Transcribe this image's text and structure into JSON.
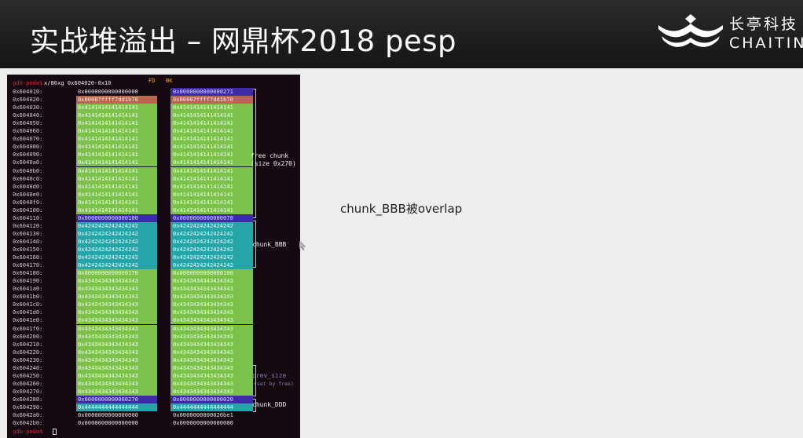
{
  "slide": {
    "title": "实战堆溢出 – 网鼎杯2018 pesp",
    "caption": "chunk_BBB被overlap"
  },
  "logo": {
    "name_cn": "长亭科技",
    "name_en": "CHAITIN",
    "icon": "chaitin-crown-logo-icon"
  },
  "terminal": {
    "prompt": "gdb-peda$",
    "command": "x/86xg 0x604020-0x10",
    "header_fd": "FD",
    "header_bk": "BK",
    "rows": [
      {
        "addr": "0x604010:",
        "c1": "0x0000000000000000",
        "c2": "0x0000000000000271",
        "s1": "k",
        "s2": "p"
      },
      {
        "addr": "0x604020:",
        "c1": "0x00007ffff7dd1b78",
        "c2": "0x00007ffff7dd1b78",
        "s1": "o",
        "s2": "o"
      },
      {
        "addr": "0x604030:",
        "c1": "0x4141414141414141",
        "c2": "0x4141414141414141",
        "s1": "g",
        "s2": "g"
      },
      {
        "addr": "0x604040:",
        "c1": "0x4141414141414141",
        "c2": "0x4141414141414141",
        "s1": "g",
        "s2": "g"
      },
      {
        "addr": "0x604050:",
        "c1": "0x4141414141414141",
        "c2": "0x4141414141414141",
        "s1": "g",
        "s2": "g"
      },
      {
        "addr": "0x604060:",
        "c1": "0x4141414141414141",
        "c2": "0x4141414141414141",
        "s1": "g",
        "s2": "g"
      },
      {
        "addr": "0x604070:",
        "c1": "0x4141414141414141",
        "c2": "0x4141414141414141",
        "s1": "g",
        "s2": "g"
      },
      {
        "addr": "0x604080:",
        "c1": "0x4141414141414141",
        "c2": "0x4141414141414141",
        "s1": "g",
        "s2": "g"
      },
      {
        "addr": "0x604090:",
        "c1": "0x4141414141414141",
        "c2": "0x4141414141414141",
        "s1": "g",
        "s2": "g"
      },
      {
        "addr": "0x6040a0:",
        "c1": "0x4141414141414141",
        "c2": "0x4141414141414141",
        "s1": "g",
        "s2": "g"
      },
      {
        "addr": "0x6040b0:",
        "c1": "0x4141414141414141",
        "c2": "0x4141414141414141",
        "s1": "g",
        "s2": "g"
      },
      {
        "addr": "0x6040c0:",
        "c1": "0x4141414141414141",
        "c2": "0x4141414141414141",
        "s1": "g",
        "s2": "g"
      },
      {
        "addr": "0x6040d0:",
        "c1": "0x4141414141414141",
        "c2": "0x4141414141414141",
        "s1": "g",
        "s2": "g"
      },
      {
        "addr": "0x6040e0:",
        "c1": "0x4141414141414141",
        "c2": "0x4141414141414141",
        "s1": "g",
        "s2": "g"
      },
      {
        "addr": "0x6040f0:",
        "c1": "0x4141414141414141",
        "c2": "0x4141414141414141",
        "s1": "g",
        "s2": "g"
      },
      {
        "addr": "0x604100:",
        "c1": "0x4141414141414141",
        "c2": "0x4141414141414141",
        "s1": "g",
        "s2": "g"
      },
      {
        "addr": "0x604110:",
        "c1": "0x0000000000000100",
        "c2": "0x0000000000000070",
        "s1": "p",
        "s2": "p"
      },
      {
        "addr": "0x604120:",
        "c1": "0x4242424242424242",
        "c2": "0x4242424242424242",
        "s1": "t",
        "s2": "t"
      },
      {
        "addr": "0x604130:",
        "c1": "0x4242424242424242",
        "c2": "0x4242424242424242",
        "s1": "t",
        "s2": "t"
      },
      {
        "addr": "0x604140:",
        "c1": "0x4242424242424242",
        "c2": "0x4242424242424242",
        "s1": "t",
        "s2": "t"
      },
      {
        "addr": "0x604150:",
        "c1": "0x4242424242424242",
        "c2": "0x4242424242424242",
        "s1": "t",
        "s2": "t"
      },
      {
        "addr": "0x604160:",
        "c1": "0x4242424242424242",
        "c2": "0x4242424242424242",
        "s1": "t",
        "s2": "t"
      },
      {
        "addr": "0x604170:",
        "c1": "0x4242424242424242",
        "c2": "0x4242424242424242",
        "s1": "t",
        "s2": "t"
      },
      {
        "addr": "0x604180:",
        "c1": "0x0000000000000170",
        "c2": "0x0000000000000100",
        "s1": "g",
        "s2": "g"
      },
      {
        "addr": "0x604190:",
        "c1": "0x4343434343434343",
        "c2": "0x4343434343434343",
        "s1": "g",
        "s2": "g"
      },
      {
        "addr": "0x6041a0:",
        "c1": "0x4343434343434343",
        "c2": "0x4343434343434343",
        "s1": "g",
        "s2": "g"
      },
      {
        "addr": "0x6041b0:",
        "c1": "0x4343434343434343",
        "c2": "0x4343434343434343",
        "s1": "g",
        "s2": "g"
      },
      {
        "addr": "0x6041c0:",
        "c1": "0x4343434343434343",
        "c2": "0x4343434343434343",
        "s1": "g",
        "s2": "g"
      },
      {
        "addr": "0x6041d0:",
        "c1": "0x4343434343434343",
        "c2": "0x4343434343434343",
        "s1": "g",
        "s2": "g"
      },
      {
        "addr": "0x6041e0:",
        "c1": "0x4343434343434343",
        "c2": "0x4343434343434343",
        "s1": "g",
        "s2": "g"
      },
      {
        "addr": "0x6041f0:",
        "c1": "0x4343434343434343",
        "c2": "0x4343434343434343",
        "s1": "g",
        "s2": "g"
      },
      {
        "addr": "0x604200:",
        "c1": "0x4343434343434343",
        "c2": "0x4343434343434343",
        "s1": "g",
        "s2": "g"
      },
      {
        "addr": "0x604210:",
        "c1": "0x4343434343434343",
        "c2": "0x4343434343434343",
        "s1": "g",
        "s2": "g"
      },
      {
        "addr": "0x604220:",
        "c1": "0x4343434343434343",
        "c2": "0x4343434343434343",
        "s1": "g",
        "s2": "g"
      },
      {
        "addr": "0x604230:",
        "c1": "0x4343434343434343",
        "c2": "0x4343434343434343",
        "s1": "g",
        "s2": "g"
      },
      {
        "addr": "0x604240:",
        "c1": "0x4343434343434343",
        "c2": "0x4343434343434343",
        "s1": "g",
        "s2": "g"
      },
      {
        "addr": "0x604250:",
        "c1": "0x4343434343434343",
        "c2": "0x4343434343434343",
        "s1": "g",
        "s2": "g"
      },
      {
        "addr": "0x604260:",
        "c1": "0x4343434343434343",
        "c2": "0x4343434343434343",
        "s1": "g",
        "s2": "g"
      },
      {
        "addr": "0x604270:",
        "c1": "0x4343434343434343",
        "c2": "0x4343434343434343",
        "s1": "g",
        "s2": "g"
      },
      {
        "addr": "0x604280:",
        "c1": "0x0000000000000270",
        "c2": "0x0000000000000020",
        "s1": "p",
        "s2": "p"
      },
      {
        "addr": "0x604290:",
        "c1": "0x4444444444444444",
        "c2": "0x4444444444444444",
        "s1": "t",
        "s2": "t"
      },
      {
        "addr": "0x6042a0:",
        "c1": "0x0000000000000000",
        "c2": "0x0000000000020be1",
        "s1": "k",
        "s2": "k"
      },
      {
        "addr": "0x6042b0:",
        "c1": "0x0000000000000000",
        "c2": "0x0000000000000000",
        "s1": "k",
        "s2": "k"
      }
    ],
    "annotations": {
      "free_chunk": "free chunk",
      "free_chunk_size": "(size 0x270)",
      "chunk_bbb": "chunk_BBB",
      "prev_size": "prev_size",
      "prev_size_note": "(set by free)",
      "chunk_ddd": "chunk_DDD"
    }
  },
  "colors": {
    "free_chunk_green": "#7cc24a",
    "chunk_teal": "#26a5a8",
    "header_purple": "#3c2aa6",
    "pointer_orange": "#b8654f",
    "prompt_red": "#d8253b"
  }
}
